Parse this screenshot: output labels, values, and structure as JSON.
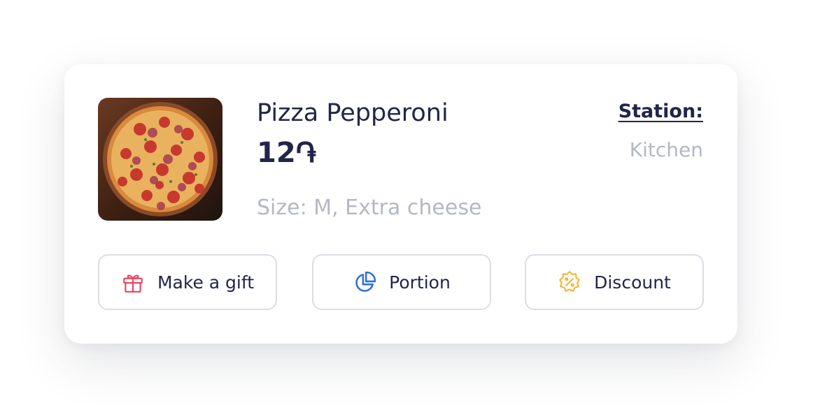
{
  "product": {
    "name": "Pizza Pepperoni",
    "price": "12֏",
    "options": "Size: M, Extra cheese",
    "image_icon": "pizza-photo"
  },
  "station": {
    "label": "Station:",
    "value": "Kitchen"
  },
  "actions": [
    {
      "label": "Make a gift",
      "icon": "gift-icon",
      "color": "#e8455e"
    },
    {
      "label": "Portion",
      "icon": "pie-chart-icon",
      "color": "#2f6fe0"
    },
    {
      "label": "Discount",
      "icon": "discount-badge-icon",
      "color": "#f2b632"
    }
  ],
  "colors": {
    "text_primary": "#22254a",
    "text_muted": "#b5b8c4",
    "border": "#dcdee4"
  }
}
